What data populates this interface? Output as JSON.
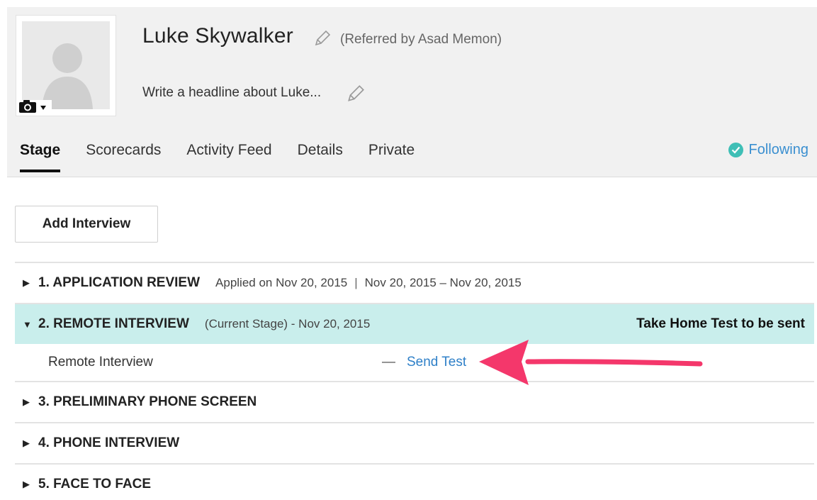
{
  "candidate": {
    "name": "Luke Skywalker",
    "referred": "(Referred by Asad Memon)",
    "headline_placeholder": "Write a headline about Luke..."
  },
  "tabs": [
    {
      "label": "Stage",
      "active": true
    },
    {
      "label": "Scorecards",
      "active": false
    },
    {
      "label": "Activity Feed",
      "active": false
    },
    {
      "label": "Details",
      "active": false
    },
    {
      "label": "Private",
      "active": false
    }
  ],
  "following": {
    "label": "Following",
    "color": "#3fbfb6"
  },
  "actions": {
    "add_interview": "Add Interview"
  },
  "stages": [
    {
      "title": "1. APPLICATION REVIEW",
      "meta_left": "Applied on Nov 20, 2015",
      "meta_right": "Nov 20, 2015 – Nov 20, 2015",
      "expanded": false
    },
    {
      "title": "2. REMOTE INTERVIEW",
      "meta": "(Current Stage) - Nov 20, 2015",
      "status": "Take Home Test to be sent",
      "expanded": true,
      "substage": {
        "label": "Remote Interview",
        "dash": "—",
        "action": "Send Test"
      }
    },
    {
      "title": "3. PRELIMINARY PHONE SCREEN",
      "expanded": false
    },
    {
      "title": "4. PHONE INTERVIEW",
      "expanded": false
    },
    {
      "title": "5. FACE TO FACE",
      "expanded": false
    }
  ],
  "colors": {
    "current_stage_bg": "#c9eeec",
    "link": "#2f80c8",
    "annotation_arrow": "#f4376b"
  },
  "icons": {
    "collapsed": "▶",
    "expanded": "▼"
  }
}
